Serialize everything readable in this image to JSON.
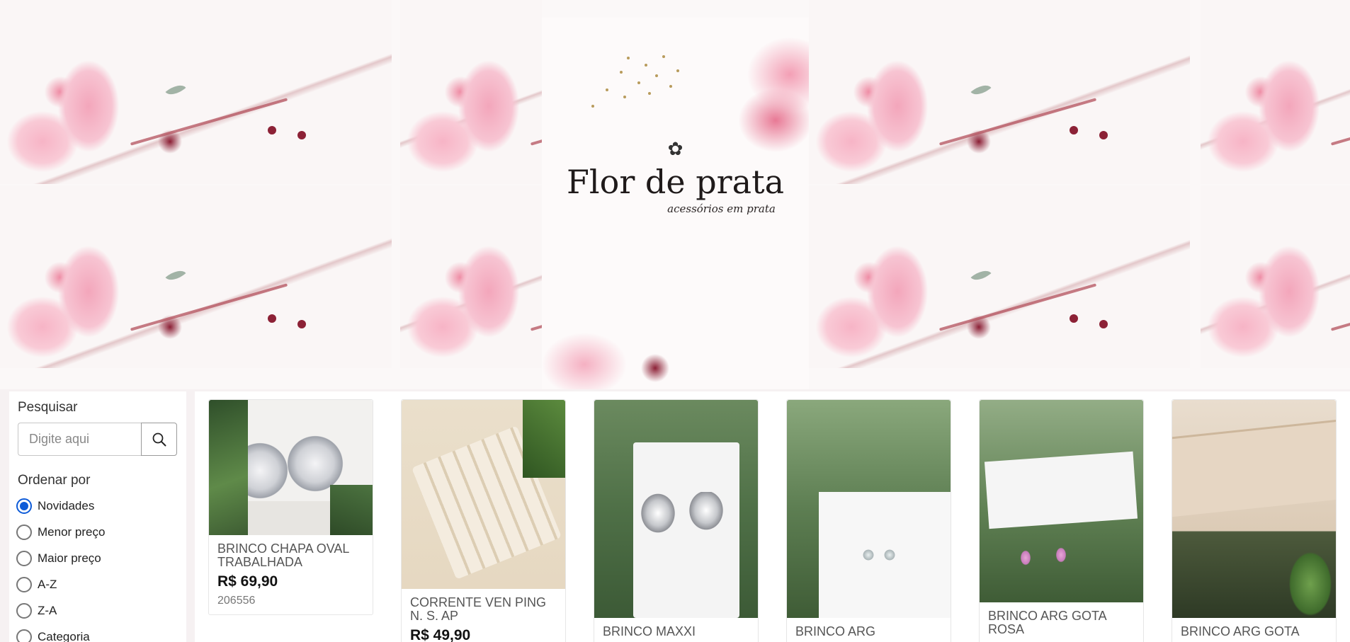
{
  "hero": {
    "logo_title": "Flor de prata",
    "logo_subtitle": "acessórios em prata"
  },
  "sidebar": {
    "search_title": "Pesquisar",
    "search_placeholder": "Digite aqui",
    "order_title": "Ordenar por",
    "options": [
      {
        "label": "Novidades",
        "checked": true
      },
      {
        "label": "Menor preço",
        "checked": false
      },
      {
        "label": "Maior preço",
        "checked": false
      },
      {
        "label": "A-Z",
        "checked": false
      },
      {
        "label": "Z-A",
        "checked": false
      },
      {
        "label": "Categoria",
        "checked": false
      }
    ]
  },
  "products": [
    {
      "name": "BRINCO CHAPA OVAL TRABALHADA",
      "price": "R$ 69,90",
      "code": "206556"
    },
    {
      "name": "CORRENTE VEN PING N. S. AP",
      "price": "R$ 49,90",
      "code": ""
    },
    {
      "name": "BRINCO MAXXI",
      "price": "",
      "code": ""
    },
    {
      "name": "BRINCO ARG",
      "price": "",
      "code": ""
    },
    {
      "name": "BRINCO ARG GOTA ROSA",
      "price": "",
      "code": ""
    },
    {
      "name": "BRINCO ARG GOTA",
      "price": "",
      "code": ""
    }
  ]
}
